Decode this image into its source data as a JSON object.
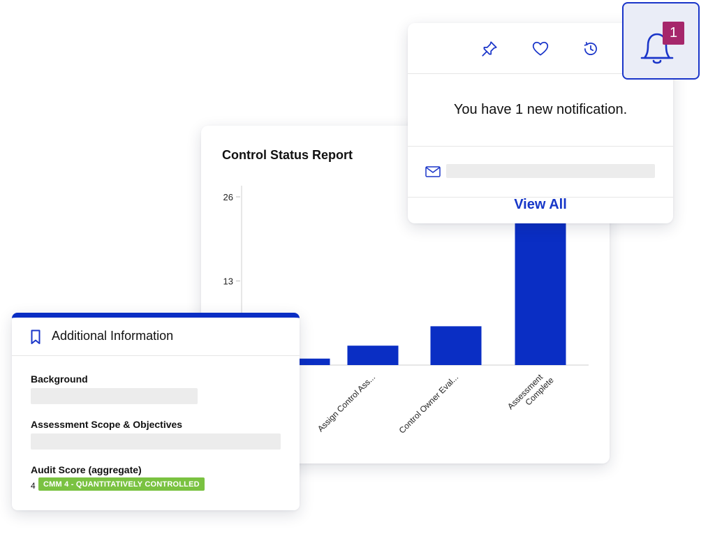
{
  "chart_data": {
    "type": "bar",
    "title": "Control Status Report",
    "categories": [
      "",
      "Assign Control Ass...",
      "Control Owner Eval...",
      "Assessment Complete"
    ],
    "category_lines": [
      [
        ""
      ],
      [
        "Assign Control Ass..."
      ],
      [
        "Control Owner Eval..."
      ],
      [
        "Assessment",
        "Complete"
      ]
    ],
    "values": [
      1,
      3,
      6,
      26
    ],
    "yticks": [
      13,
      26
    ],
    "ylim": [
      0,
      26
    ],
    "bar_color": "#0a2ec4"
  },
  "notification": {
    "message": "You have 1 new notification.",
    "view_all": "View All",
    "badge_count": "1",
    "accent_color": "#1a35c9",
    "toolbar_icons": [
      "pin-icon",
      "heart-icon",
      "history-icon"
    ]
  },
  "info": {
    "title": "Additional Information",
    "fields": [
      {
        "label": "Background"
      },
      {
        "label": "Assessment Scope & Objectives"
      }
    ],
    "audit_label": "Audit Score (aggregate)",
    "audit_value": "4",
    "audit_tag": "CMM 4 - QUANTITATIVELY CONTROLLED",
    "tag_color": "#7ac241"
  }
}
